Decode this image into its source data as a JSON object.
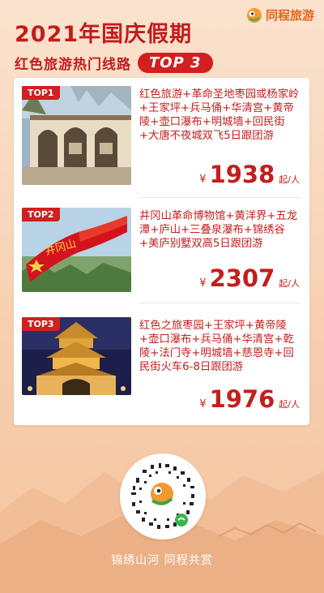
{
  "header": {
    "title": "2021年国庆假期",
    "subtitle": "红色旅游热门线路",
    "badge": "TOP 3"
  },
  "brand": {
    "name": "同程旅游"
  },
  "routes": [
    {
      "rank": "TOP1",
      "description": "红色旅游+革命圣地枣园或杨家岭+王家坪+兵马俑+华清宫+黄帝陵+壶口瀑布+明城墙+回民街+大唐不夜城双飞5日跟团游",
      "currency": "¥",
      "price": "1938",
      "unit": "起/人"
    },
    {
      "rank": "TOP2",
      "description": "井冈山革命博物馆+黄洋界+五龙潭+庐山+三叠泉瀑布+锦绣谷+美庐别墅双高5日跟团游",
      "currency": "¥",
      "price": "2307",
      "unit": "起/人"
    },
    {
      "rank": "TOP3",
      "description": "红色之旅枣园+王家坪+黄帝陵+壶口瀑布+兵马俑+华清宫+乾陵+法门寺+明城墙+慈恩寺+回民街火车6-8日跟团游",
      "currency": "¥",
      "price": "1976",
      "unit": "起/人"
    }
  ],
  "footer": {
    "slogan": "锦绣山河 同程共赏"
  },
  "colors": {
    "accent_red": "#c31c1c",
    "badge_red": "#d21f1f",
    "brand_orange": "#e8641c",
    "background": "#f7d0b0"
  }
}
